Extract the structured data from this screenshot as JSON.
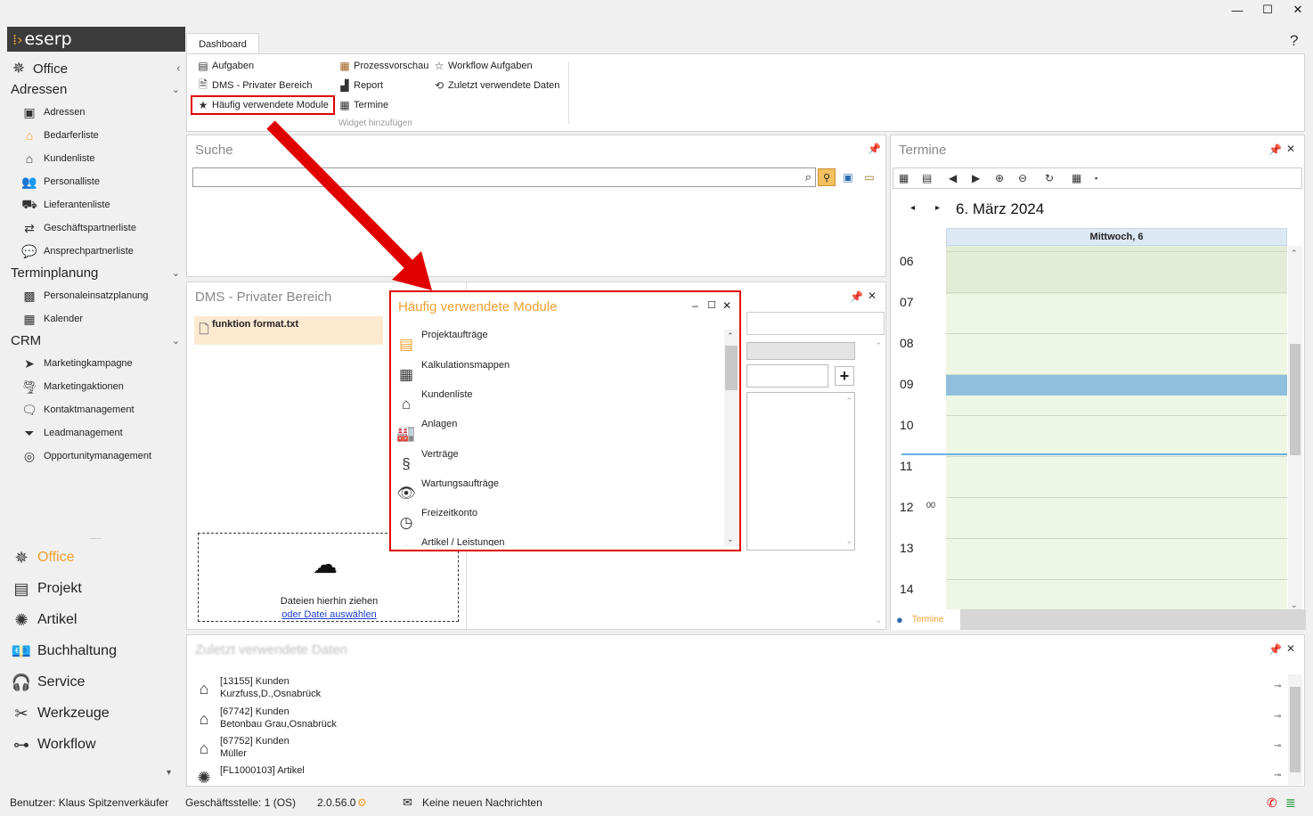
{
  "window": {
    "minimize": "—",
    "maximize": "☐",
    "close": "✕",
    "help": "?"
  },
  "app": {
    "logo": "eserp"
  },
  "sidebar": {
    "top_section": "Office",
    "groups": [
      {
        "label": "Adressen",
        "items": [
          "Adressen",
          "Bedarferliste",
          "Kundenliste",
          "Personalliste",
          "Lieferantenliste",
          "Geschäftspartnerliste",
          "Ansprechpartnerliste"
        ]
      },
      {
        "label": "Terminplanung",
        "items": [
          "Personaleinsatzplanung",
          "Kalender"
        ]
      },
      {
        "label": "CRM",
        "items": [
          "Marketingkampagne",
          "Marketingaktionen",
          "Kontaktmanagement",
          "Leadmanagement",
          "Opportunitymanagement"
        ]
      }
    ],
    "modules": [
      "Office",
      "Projekt",
      "Artikel",
      "Buchhaltung",
      "Service",
      "Werkzeuge",
      "Workflow"
    ],
    "splitter": "......"
  },
  "ribbon": {
    "tab": "Dashboard",
    "col1": [
      "Aufgaben",
      "DMS - Privater Bereich",
      "Häufig verwendete Module"
    ],
    "col2": [
      "Prozessvorschau",
      "Report",
      "Termine"
    ],
    "col3": [
      "Workflow Aufgaben",
      "Zuletzt verwendete Daten"
    ],
    "group_label": "Widget hinzufügen"
  },
  "search_panel": {
    "title": "Suche",
    "value": ""
  },
  "dms_panel": {
    "title": "DMS - Privater Bereich",
    "file": "funktion format.txt",
    "drop_text": "Dateien hierhin ziehen",
    "drop_link": "oder Datei auswählen"
  },
  "termine_panel": {
    "title": "Termine",
    "date": "6. März 2024",
    "day_header": "Mittwoch, 6",
    "hours": [
      "06",
      "07",
      "08",
      "09",
      "10",
      "11",
      "12",
      "13",
      "14"
    ],
    "noon_minutes": "00",
    "tab": "Termine"
  },
  "modal": {
    "title": "Häufig verwendete Module",
    "items": [
      "Projektaufträge",
      "Kalkulationsmappen",
      "Kundenliste",
      "Anlagen",
      "Verträge",
      "Wartungsaufträge",
      "Freizeitkonto",
      "Artikel / Leistungen"
    ]
  },
  "recent_panel": {
    "title": "Zuletzt verwendete Daten",
    "items": [
      {
        "line1": "[13155] Kunden",
        "line2": "Kurzfuss,D.,Osnabrück"
      },
      {
        "line1": "[67742] Kunden",
        "line2": "Betonbau Grau,Osnabrück"
      },
      {
        "line1": "[67752] Kunden",
        "line2": "Müller"
      },
      {
        "line1": "[FL1000103] Artikel",
        "line2": ""
      }
    ]
  },
  "status": {
    "user": "Benutzer: Klaus Spitzenverkäufer",
    "branch": "Geschäftsstelle: 1 (OS)",
    "version": "2.0.56.0",
    "messages": "Keine neuen Nachrichten"
  },
  "colors": {
    "accent": "#f0a030",
    "highlight": "#e00000",
    "calendar_green": "#eef7e4",
    "appointment": "#8fbfdc"
  }
}
